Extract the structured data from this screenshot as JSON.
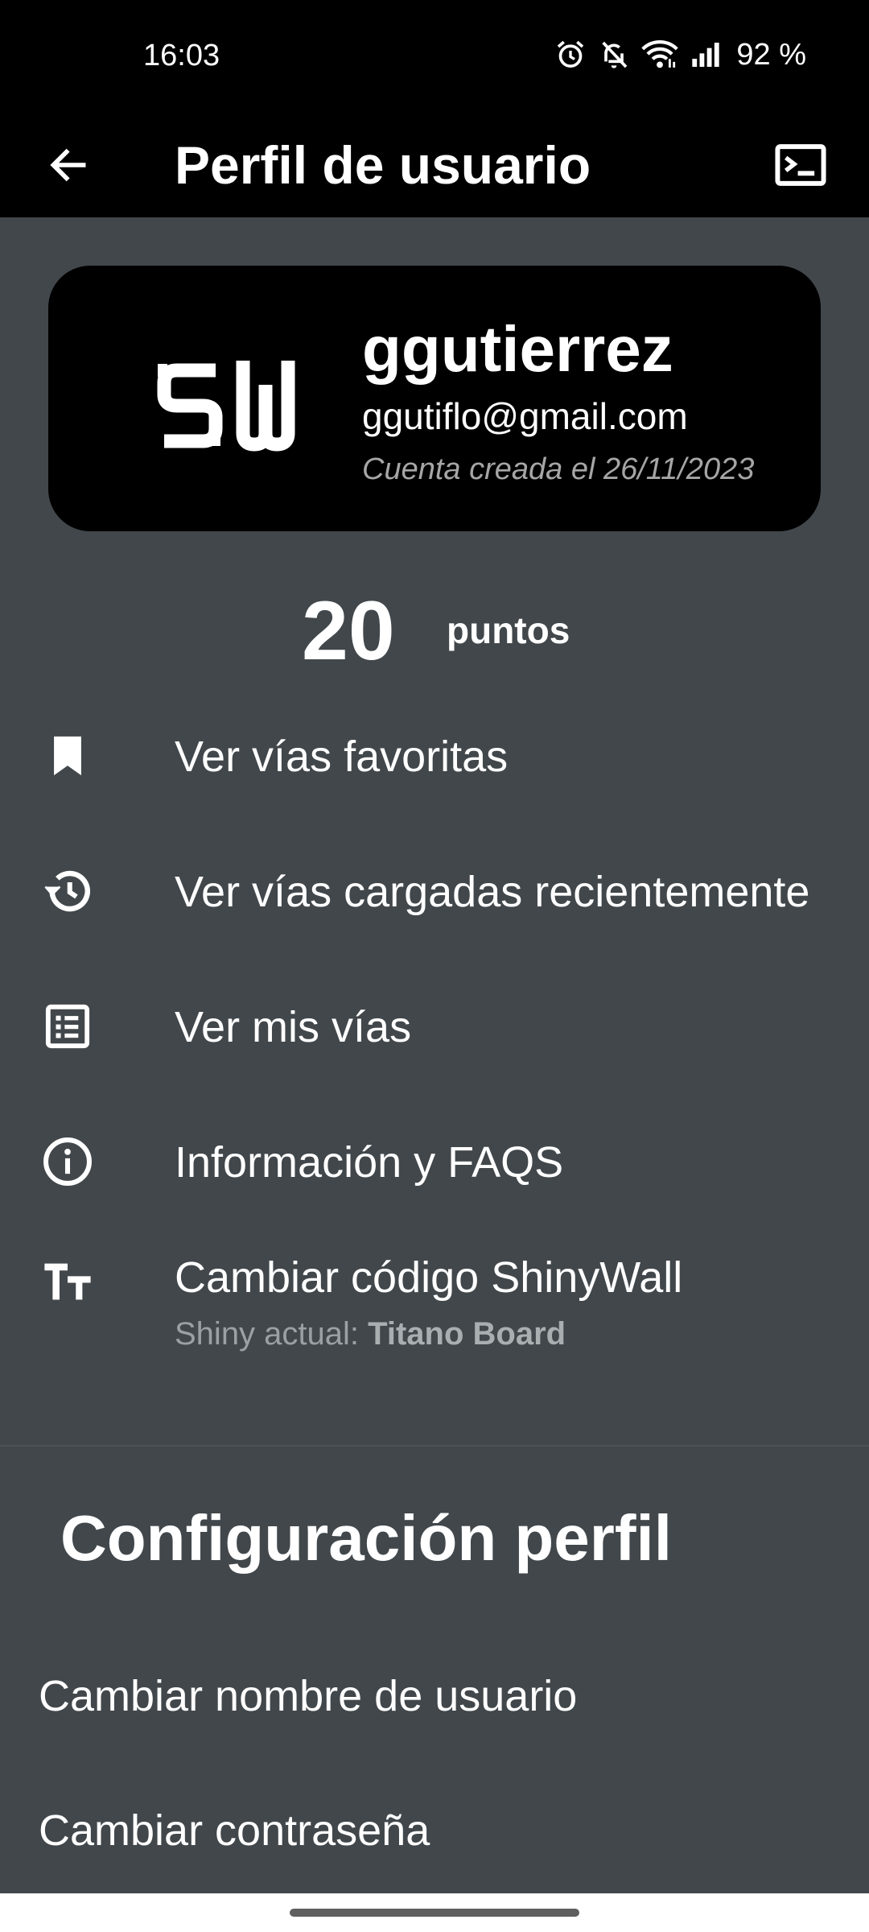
{
  "status_bar": {
    "time": "16:03",
    "battery": "92 %",
    "icons": [
      "alarm-icon",
      "bell-off-icon",
      "wifi-icon",
      "signal-icon"
    ]
  },
  "app_bar": {
    "title": "Perfil de usuario",
    "back_icon": "arrow-left-icon",
    "action_icon": "terminal-icon"
  },
  "profile": {
    "logo_text": "SW",
    "username": "ggutierrez",
    "email": "ggutiflo@gmail.com",
    "created": "Cuenta creada el 26/11/2023"
  },
  "points": {
    "value": "20",
    "label": "puntos"
  },
  "menu": {
    "items": [
      {
        "label": "Ver vías favoritas",
        "icon": "bookmark-icon"
      },
      {
        "label": "Ver vías cargadas recientemente",
        "icon": "history-icon"
      },
      {
        "label": "Ver mis vías",
        "icon": "list-icon"
      },
      {
        "label": "Información y FAQS",
        "icon": "info-icon"
      },
      {
        "label": "Cambiar código ShinyWall",
        "icon": "text-size-icon",
        "sub_prefix": "Shiny actual: ",
        "sub_value": "Titano Board"
      }
    ]
  },
  "settings": {
    "title": "Configuración perfil",
    "items": [
      {
        "label": "Cambiar nombre de usuario"
      },
      {
        "label": "Cambiar contraseña"
      }
    ]
  },
  "colors": {
    "background": "#41474b",
    "app_bar": "#000000",
    "card": "#000000",
    "text": "#ffffff",
    "muted_text": "#9aa0a3"
  }
}
